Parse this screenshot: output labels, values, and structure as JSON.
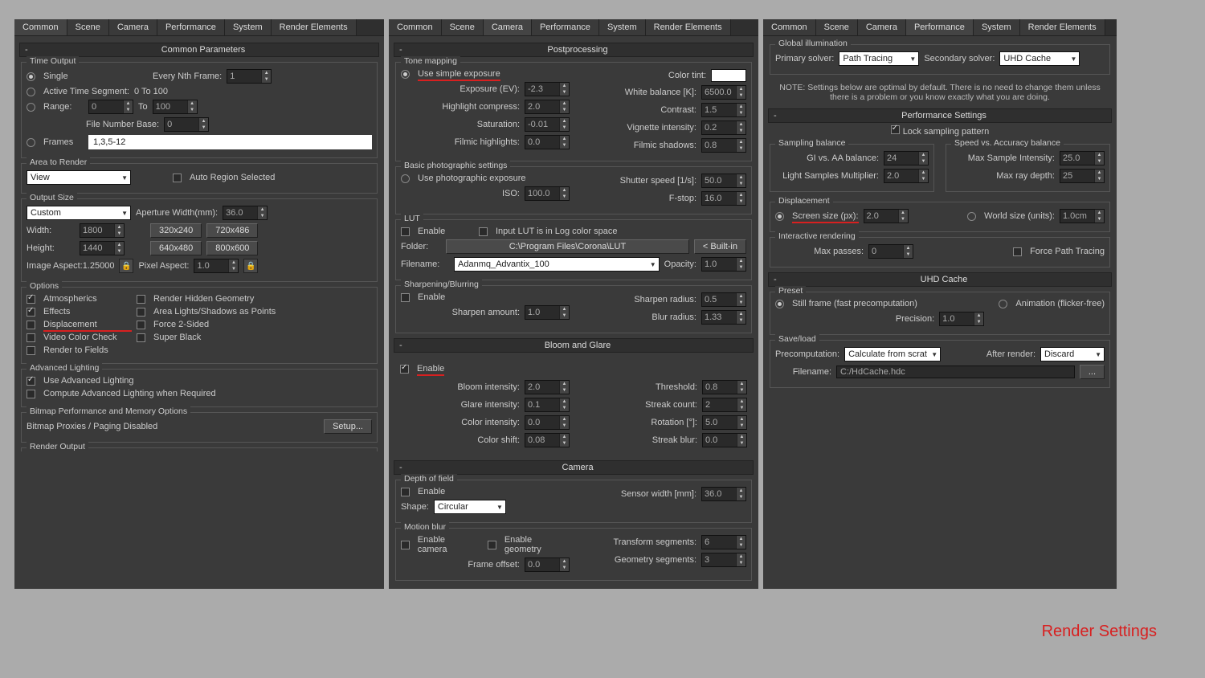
{
  "tabs": [
    "Common",
    "Scene",
    "Camera",
    "Performance",
    "System",
    "Render Elements"
  ],
  "panel1": {
    "activeTab": "Common",
    "rollup": "Common Parameters",
    "timeOutput": {
      "groupTitle": "Time Output",
      "single": "Single",
      "everyNth": "Every Nth Frame:",
      "everyNthVal": "1",
      "activeSeg": "Active Time Segment:",
      "activeSegVal": "0 To 100",
      "range": "Range:",
      "rangeFrom": "0",
      "to": "To",
      "rangeTo": "100",
      "fileNumBase": "File Number Base:",
      "fileNumBaseVal": "0",
      "frames": "Frames",
      "framesVal": "1,3,5-12"
    },
    "area": {
      "groupTitle": "Area to Render",
      "value": "View",
      "autoRegion": "Auto Region Selected"
    },
    "output": {
      "groupTitle": "Output Size",
      "preset": "Custom",
      "aperture": "Aperture Width(mm):",
      "apertureVal": "36.0",
      "widthLbl": "Width:",
      "widthVal": "1800",
      "heightLbl": "Height:",
      "heightVal": "1440",
      "b1": "320x240",
      "b2": "720x486",
      "b3": "640x480",
      "b4": "800x600",
      "imgAspect": "Image Aspect:1.25000",
      "pixAspect": "Pixel Aspect:",
      "pixAspectVal": "1.0"
    },
    "options": {
      "groupTitle": "Options",
      "atmos": "Atmospherics",
      "renderHidden": "Render Hidden Geometry",
      "effects": "Effects",
      "areaLights": "Area Lights/Shadows as Points",
      "displacement": "Displacement",
      "force2": "Force 2-Sided",
      "videoCheck": "Video Color Check",
      "superBlack": "Super Black",
      "renderFields": "Render to Fields"
    },
    "advLight": {
      "groupTitle": "Advanced Lighting",
      "use": "Use Advanced Lighting",
      "compute": "Compute Advanced Lighting when Required"
    },
    "bitmap": {
      "groupTitle": "Bitmap Performance and Memory Options",
      "line": "Bitmap Proxies / Paging Disabled",
      "setup": "Setup..."
    },
    "renderOutput": "Render Output"
  },
  "panel2": {
    "activeTab": "Camera",
    "postprocessing": "Postprocessing",
    "tone": {
      "groupTitle": "Tone mapping",
      "useSimple": "Use simple exposure",
      "exposureEV": "Exposure (EV):",
      "exposureVal": "-2.3",
      "highlight": "Highlight compress:",
      "highlightVal": "2.0",
      "saturation": "Saturation:",
      "saturationVal": "-0.01",
      "filmicHi": "Filmic highlights:",
      "filmicHiVal": "0.0",
      "colorTint": "Color tint:",
      "whiteBal": "White balance [K]:",
      "whiteBalVal": "6500.0",
      "contrast": "Contrast:",
      "contrastVal": "1.5",
      "vignette": "Vignette intensity:",
      "vignetteVal": "0.2",
      "filmicSh": "Filmic shadows:",
      "filmicShVal": "0.8"
    },
    "photo": {
      "groupTitle": "Basic photographic settings",
      "usePhoto": "Use photographic exposure",
      "iso": "ISO:",
      "isoVal": "100.0",
      "shutter": "Shutter speed [1/s]:",
      "shutterVal": "50.0",
      "fstop": "F-stop:",
      "fstopVal": "16.0"
    },
    "lut": {
      "groupTitle": "LUT",
      "enable": "Enable",
      "inputLog": "Input LUT is in Log color space",
      "folder": "Folder:",
      "folderVal": "C:\\Program Files\\Corona\\LUT",
      "builtin": "< Built-in",
      "filename": "Filename:",
      "filenameVal": "Adanmq_Advantix_100",
      "opacity": "Opacity:",
      "opacityVal": "1.0"
    },
    "sharpen": {
      "groupTitle": "Sharpening/Blurring",
      "enable": "Enable",
      "amount": "Sharpen amount:",
      "amountVal": "1.0",
      "radius": "Sharpen radius:",
      "radiusVal": "0.5",
      "blur": "Blur radius:",
      "blurVal": "1.33"
    },
    "bloom": {
      "title": "Bloom and Glare",
      "enable": "Enable",
      "bloomI": "Bloom intensity:",
      "bloomIVal": "2.0",
      "glareI": "Glare intensity:",
      "glareIVal": "0.1",
      "colorI": "Color intensity:",
      "colorIVal": "0.0",
      "colorShift": "Color shift:",
      "colorShiftVal": "0.08",
      "threshold": "Threshold:",
      "thresholdVal": "0.8",
      "streakCount": "Streak count:",
      "streakCountVal": "2",
      "rotation": "Rotation [°]:",
      "rotationVal": "5.0",
      "streakBlur": "Streak blur:",
      "streakBlurVal": "0.0"
    },
    "camera": {
      "title": "Camera",
      "dof": "Depth of field",
      "enable": "Enable",
      "sensorWidth": "Sensor width [mm]:",
      "sensorWidthVal": "36.0",
      "shape": "Shape:",
      "shapeVal": "Circular",
      "motion": "Motion blur",
      "enableCam": "Enable camera",
      "enableGeom": "Enable geometry",
      "transSeg": "Transform segments:",
      "transSegVal": "6",
      "frameOff": "Frame offset:",
      "frameOffVal": "0.0",
      "geomSeg": "Geometry segments:",
      "geomSegVal": "3"
    }
  },
  "panel3": {
    "activeTab": "Performance",
    "gi": {
      "groupTitle": "Global illumination",
      "primary": "Primary solver:",
      "primaryVal": "Path Tracing",
      "secondary": "Secondary solver:",
      "secondaryVal": "UHD Cache"
    },
    "note": "NOTE: Settings below are optimal by default. There is no need to change them unless there is a problem or you know exactly what you are doing.",
    "perf": {
      "title": "Performance Settings",
      "lock": "Lock sampling pattern",
      "sampBal": "Sampling balance",
      "giAA": "GI vs. AA balance:",
      "giAAVal": "24",
      "lightSamples": "Light Samples Multiplier:",
      "lightSamplesVal": "2.0",
      "speedAcc": "Speed vs. Accuracy balance",
      "maxSample": "Max Sample Intensity:",
      "maxSampleVal": "25.0",
      "maxRay": "Max ray depth:",
      "maxRayVal": "25",
      "displacement": "Displacement",
      "screenSize": "Screen size (px):",
      "screenSizeVal": "2.0",
      "worldSize": "World size (units):",
      "worldSizeVal": "1.0cm",
      "interactive": "Interactive rendering",
      "maxPasses": "Max passes:",
      "maxPassesVal": "0",
      "forcePath": "Force Path Tracing"
    },
    "uhd": {
      "title": "UHD Cache",
      "preset": "Preset",
      "still": "Still frame (fast precomputation)",
      "anim": "Animation (flicker-free)",
      "precision": "Precision:",
      "precisionVal": "1.0",
      "saveLoad": "Save/load",
      "precomp": "Precomputation:",
      "precompVal": "Calculate from scrat",
      "after": "After render:",
      "afterVal": "Discard",
      "filename": "Filename:",
      "filenameVal": "C:/HdCache.hdc"
    }
  },
  "redNote": "Render Settings"
}
